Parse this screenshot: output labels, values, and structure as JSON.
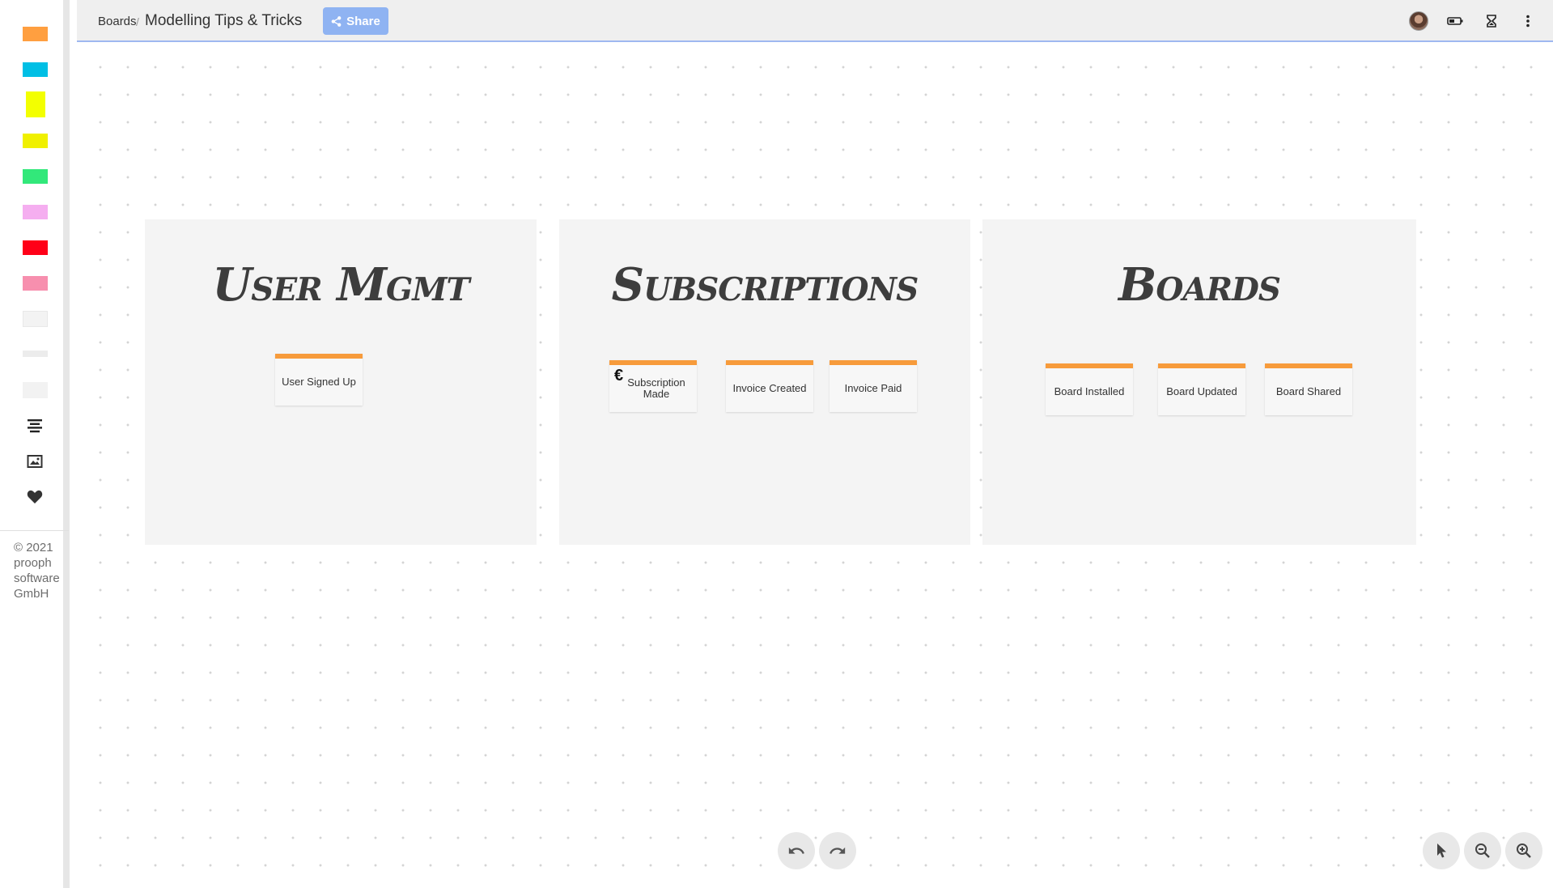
{
  "sidebar": {
    "colors": {
      "orange": "#ff9f40",
      "cyan": "#00bfe5",
      "yellow_tall": "#f3ff00",
      "yellow": "#f0f000",
      "green": "#32e87a",
      "pink": "#f5aef0",
      "red": "#ff0018",
      "rose": "#f78fae",
      "light_gray": "#f3f3f3",
      "thin_gray": "#ececec",
      "box_gray": "#f2f2f2"
    },
    "icons": [
      "align-center-icon",
      "image-icon",
      "heart-icon"
    ],
    "copyright": [
      "© 2021",
      "prooph",
      "software",
      "GmbH"
    ]
  },
  "topbar": {
    "breadcrumb_root": "Boards",
    "separator": "/",
    "title": "Modelling Tips & Tricks",
    "share_label": "Share",
    "icons": [
      "avatar",
      "battery-icon",
      "hourglass-icon",
      "more-vert-icon"
    ],
    "accent": "#8fb3f2"
  },
  "canvas": {
    "frames": [
      {
        "title": "User Mgmt",
        "stickies": [
          {
            "label": "User Signed Up"
          }
        ]
      },
      {
        "title": "Subscriptions",
        "stickies": [
          {
            "label": "Subscription Made",
            "icon": "euro-icon",
            "icon_glyph": "€"
          },
          {
            "label": "Invoice Created"
          },
          {
            "label": "Invoice Paid"
          }
        ]
      },
      {
        "title": "Boards",
        "stickies": [
          {
            "label": "Board Installed"
          },
          {
            "label": "Board Updated"
          },
          {
            "label": "Board Shared"
          }
        ]
      }
    ],
    "event_color": "#f79b3b"
  },
  "controls": {
    "history": [
      "undo-icon",
      "redo-icon"
    ],
    "view": [
      "pointer-icon",
      "zoom-out-icon",
      "zoom-in-icon"
    ]
  }
}
